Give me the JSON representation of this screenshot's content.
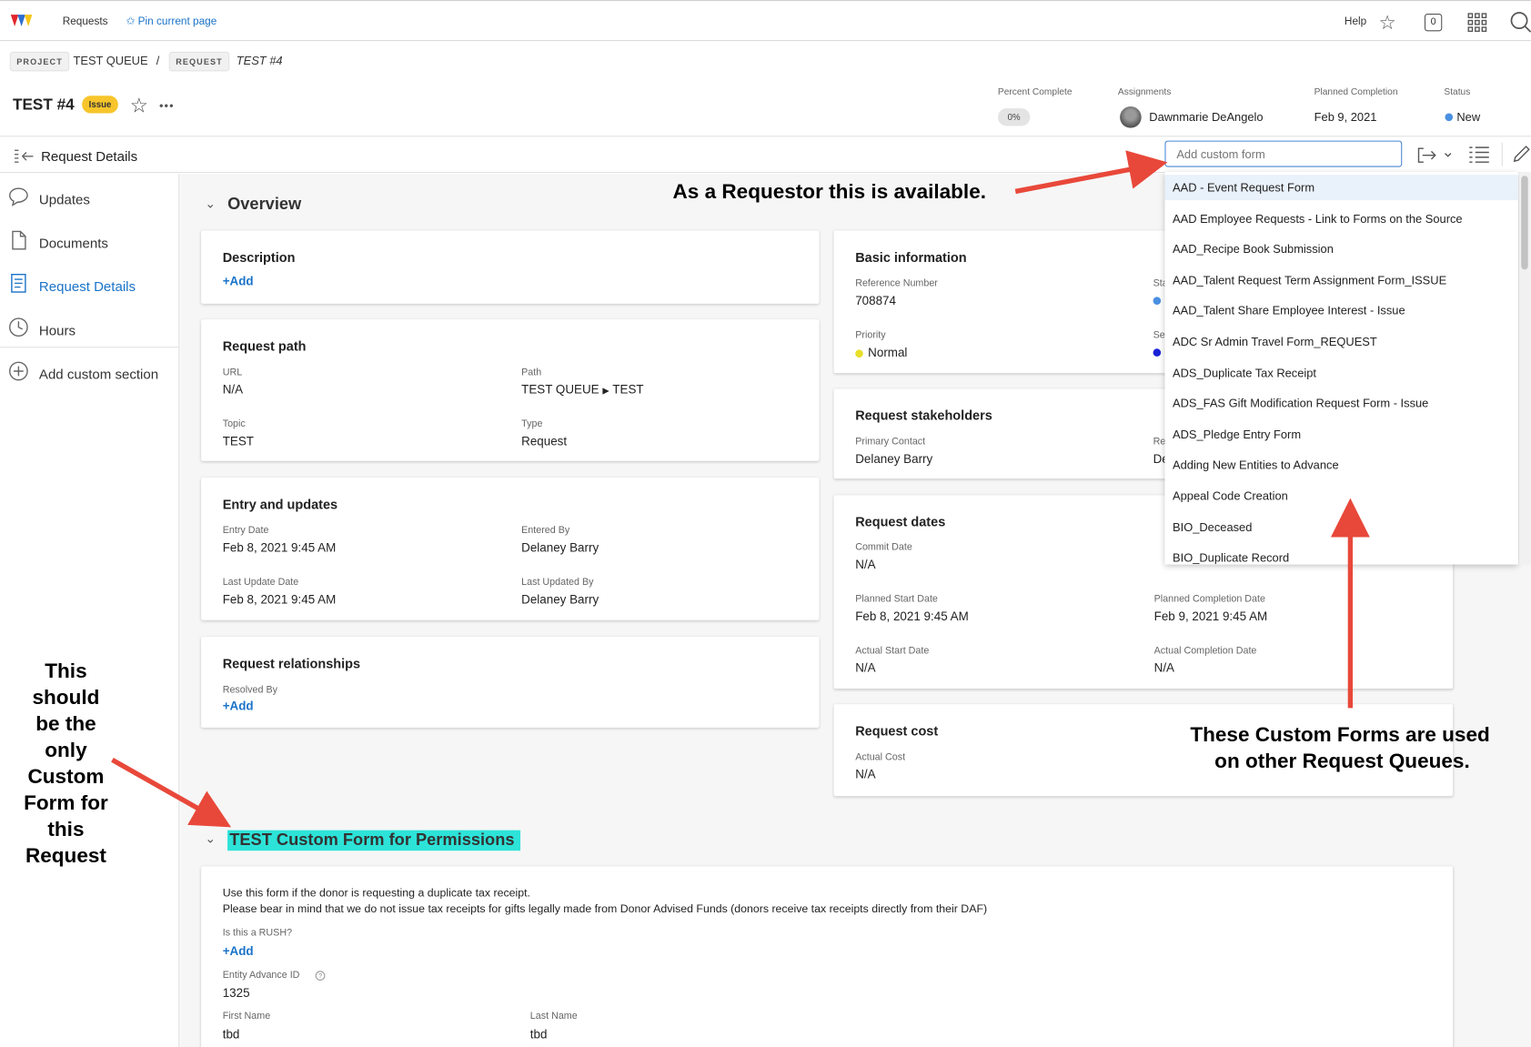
{
  "topbar": {
    "requests_label": "Requests",
    "pin_label": "Pin current page",
    "help_label": "Help",
    "notifications_count": "0"
  },
  "breadcrumb": {
    "project_tag": "PROJECT",
    "project_name": "TEST QUEUE",
    "separator": "/",
    "request_tag": "REQUEST",
    "request_name": "TEST #4"
  },
  "header": {
    "title": "TEST #4",
    "badge": "Issue",
    "more": "•••",
    "percent_label": "Percent Complete",
    "percent_value": "0%",
    "assign_label": "Assignments",
    "assignee": "Dawnmarie DeAngelo",
    "planned_label": "Planned Completion",
    "planned_value": "Feb 9, 2021",
    "status_label": "Status",
    "status_value": "New",
    "status_color": "#4a90e2"
  },
  "toolbar": {
    "section_title": "Request Details",
    "custom_form_placeholder": "Add custom form"
  },
  "sidebar": {
    "items": [
      {
        "label": "Updates",
        "icon": "speech-bubble-icon"
      },
      {
        "label": "Documents",
        "icon": "document-icon"
      },
      {
        "label": "Request Details",
        "icon": "details-icon"
      },
      {
        "label": "Hours",
        "icon": "clock-icon"
      },
      {
        "label": "Add custom section",
        "icon": "plus-circle-icon"
      }
    ]
  },
  "overview": {
    "title": "Overview",
    "description": {
      "title": "Description",
      "add": "+Add"
    },
    "request_path": {
      "title": "Request path",
      "url_label": "URL",
      "url_value": "N/A",
      "path_label": "Path",
      "path_value_1": "TEST QUEUE",
      "path_value_2": "TEST",
      "topic_label": "Topic",
      "topic_value": "TEST",
      "type_label": "Type",
      "type_value": "Request"
    },
    "entry": {
      "title": "Entry and updates",
      "entry_date_label": "Entry Date",
      "entry_date": "Feb 8, 2021 9:45 AM",
      "entered_by_label": "Entered By",
      "entered_by": "Delaney Barry",
      "last_update_label": "Last Update Date",
      "last_update": "Feb 8, 2021 9:45 AM",
      "last_updated_by_label": "Last Updated By",
      "last_updated_by": "Delaney Barry"
    },
    "relationships": {
      "title": "Request relationships",
      "resolved_label": "Resolved By",
      "add": "+Add"
    },
    "basic": {
      "title": "Basic information",
      "ref_label": "Reference Number",
      "ref_value": "708874",
      "priority_label": "Priority",
      "priority_value": "Normal",
      "status_label_partial": "Sta",
      "severity_label_partial": "Se"
    },
    "stakeholders": {
      "title": "Request stakeholders",
      "primary_label": "Primary Contact",
      "primary_value": "Delaney Barry",
      "requestor_label_partial": "Re",
      "requestor_value_partial": "De"
    },
    "dates": {
      "title": "Request dates",
      "commit_label": "Commit Date",
      "commit_value": "N/A",
      "planned_start_label": "Planned Start Date",
      "planned_start": "Feb 8, 2021 9:45 AM",
      "planned_completion_label": "Planned Completion Date",
      "planned_completion": "Feb 9, 2021 9:45 AM",
      "actual_start_label": "Actual Start Date",
      "actual_start": "N/A",
      "actual_completion_label": "Actual Completion Date",
      "actual_completion": "N/A"
    },
    "cost": {
      "title": "Request cost",
      "actual_label": "Actual Cost",
      "actual_value": "N/A"
    }
  },
  "custom_form_section": {
    "title": "TEST Custom Form for Permissions",
    "line1": "Use this form if the donor is requesting a duplicate tax receipt.",
    "line2": "Please bear in mind that we do not issue tax receipts for gifts legally made from Donor Advised Funds (donors receive tax receipts directly from their DAF)",
    "rush_label": "Is this a RUSH?",
    "rush_add": "+Add",
    "entity_label": "Entity Advance ID",
    "entity_value": "1325",
    "first_label": "First Name",
    "first_value": "tbd",
    "last_label": "Last Name",
    "last_value": "tbd"
  },
  "custom_form_options": [
    "AAD - Event Request Form",
    "AAD Employee Requests - Link to Forms on the Source",
    "AAD_Recipe Book Submission",
    "AAD_Talent Request Term Assignment Form_ISSUE",
    "AAD_Talent Share Employee Interest - Issue",
    "ADC Sr Admin Travel Form_REQUEST",
    "ADS_Duplicate Tax Receipt",
    "ADS_FAS Gift Modification Request Form - Issue",
    "ADS_Pledge Entry Form",
    "Adding New Entities to Advance",
    "Appeal Code  Creation",
    "BIO_Deceased",
    "BIO_Duplicate Record"
  ],
  "annotations": {
    "requestor": "As a Requestor this is available.",
    "other_queues_1": "These Custom Forms are used",
    "other_queues_2": "on other Request Queues.",
    "only_form": [
      "This",
      "should",
      "be the",
      "only",
      "Custom",
      "Form for",
      "this",
      "Request"
    ]
  },
  "colors": {
    "accent": "#1a73c8",
    "arrow": "#e8483a",
    "highlight": "#2de3d8",
    "badge": "#f7c52b"
  }
}
